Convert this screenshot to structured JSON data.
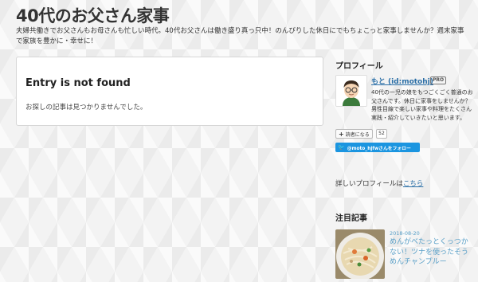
{
  "header": {
    "title": "40代のお父さん家事",
    "description": "夫婦共働きでお父さんもお母さんも忙しい時代。40代お父さんは働き盛り真っ只中！のんびりした休日にでもちょこっと家事しませんか？週末家事で家族を豊かに・幸せに！"
  },
  "entry": {
    "title": "Entry is not found",
    "message": "お探しの記事は見つかりませんでした。"
  },
  "sidebar": {
    "profile": {
      "heading": "プロフィール",
      "name": "もと (id:motohj)",
      "badge": "PRO",
      "bio": "40代の一児の娘をもつごくごく普通のお父さんです。休日に家事をしませんか？男性目線で楽しい家事や料理をたくさん実践・紹介していきたいと思います。",
      "reader_button": "読者になる",
      "reader_count": "52",
      "twitter_follow": "@moto_hjfwさんをフォロー",
      "details_prefix": "詳しいプロフィールは",
      "details_link": "こちら"
    },
    "featured": {
      "heading": "注目記事",
      "date": "2018-08-20",
      "title": "めんがべたっとくっつかない！ツナを使ったそうめんチャンプルー"
    }
  }
}
